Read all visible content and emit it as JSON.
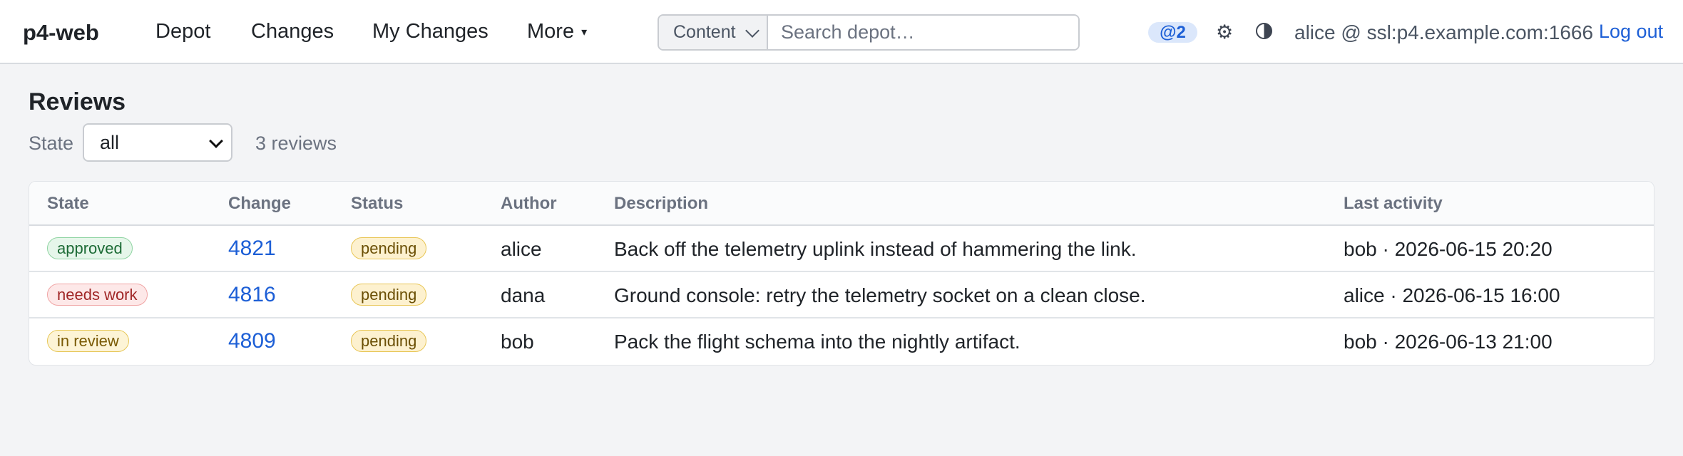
{
  "header": {
    "brand": "p4-web",
    "nav": [
      "Depot",
      "Changes",
      "My Changes",
      "More"
    ],
    "more_caret": "▾",
    "search": {
      "scope": "Content",
      "placeholder": "Search depot…"
    },
    "mentions_badge": "@2",
    "settings_icon": "gear-icon",
    "theme_icon": "contrast-icon",
    "user": "alice @ ssl:p4.example.com:1666",
    "logout": "Log out"
  },
  "page": {
    "title": "Reviews",
    "state_label": "State",
    "state_value": "all",
    "count": "3 reviews"
  },
  "table": {
    "columns": [
      "State",
      "Change",
      "Status",
      "Author",
      "Description",
      "Last activity"
    ],
    "rows": [
      {
        "state": "approved",
        "change": "4821",
        "status": "pending",
        "author": "alice",
        "description": "Back off the telemetry uplink instead of hammering the link.",
        "last_activity": "bob · 2026-06-15 20:20"
      },
      {
        "state": "needs work",
        "change": "4816",
        "status": "pending",
        "author": "dana",
        "description": "Ground console: retry the telemetry socket on a clean close.",
        "last_activity": "alice · 2026-06-15 16:00"
      },
      {
        "state": "in review",
        "change": "4809",
        "status": "pending",
        "author": "bob",
        "description": "Pack the flight schema into the nightly artifact.",
        "last_activity": "bob · 2026-06-13 21:00"
      }
    ]
  },
  "colors": {
    "link": "#1d5fd6",
    "approved": "#1c6b35",
    "needs_work": "#a02626",
    "in_review": "#7a5a04",
    "pending": "#6b4f05"
  }
}
